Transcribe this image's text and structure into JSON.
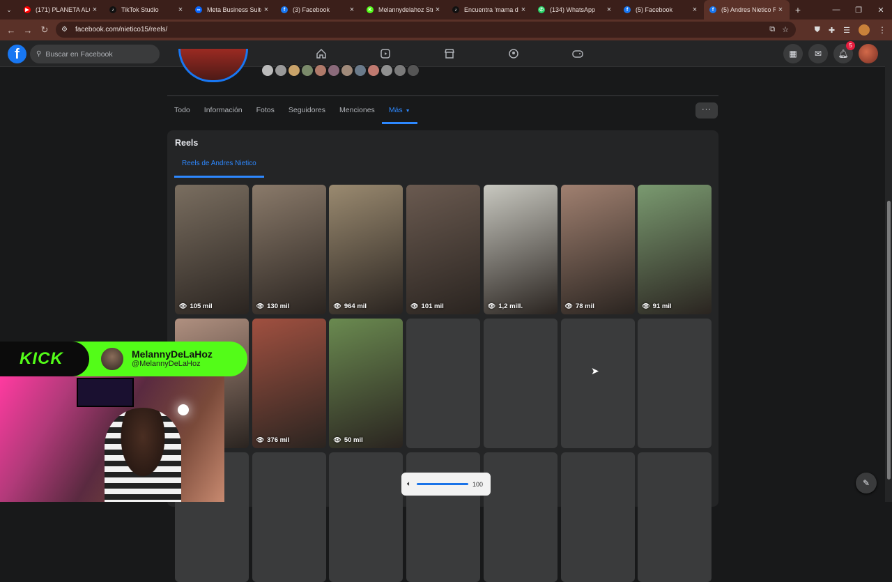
{
  "browser": {
    "tabs": [
      {
        "title": "(171) PLANETA ALOF",
        "color": "#ff0000",
        "glyph": "▶"
      },
      {
        "title": "TikTok Studio",
        "color": "#111111",
        "glyph": "♪"
      },
      {
        "title": "Meta Business Suite",
        "color": "#0866ff",
        "glyph": "∞"
      },
      {
        "title": "(3) Facebook",
        "color": "#1877f2",
        "glyph": "f"
      },
      {
        "title": "Melannydelahoz Stre",
        "color": "#53fc18",
        "glyph": "K"
      },
      {
        "title": "Encuentra 'mama de",
        "color": "#111111",
        "glyph": "♪"
      },
      {
        "title": "(134) WhatsApp",
        "color": "#25d366",
        "glyph": "✆"
      },
      {
        "title": "(5) Facebook",
        "color": "#1877f2",
        "glyph": "f"
      },
      {
        "title": "(5) Andres Nietico Re",
        "color": "#1877f2",
        "glyph": "f",
        "active": true
      }
    ],
    "url": "facebook.com/nietico15/reels/"
  },
  "fb": {
    "search_placeholder": "Buscar en Facebook",
    "notification_count": "5"
  },
  "profile_tabs": [
    "Todo",
    "Información",
    "Fotos",
    "Seguidores",
    "Menciones",
    "Más"
  ],
  "reels": {
    "title": "Reels",
    "subtab": "Reels de Andres Nietico",
    "row1": [
      "105 mil",
      "130 mil",
      "964 mil",
      "101 mil",
      "1,2 mill.",
      "78 mil",
      "91 mil"
    ],
    "row2": [
      "",
      "376 mil",
      "50 mil",
      "",
      "",
      "",
      ""
    ],
    "tile_colors_row1": [
      "#7a6e60",
      "#8a7a6a",
      "#9a8a70",
      "#6a5a50",
      "#c8c8c0",
      "#a08070",
      "#7a9a70"
    ],
    "tile_colors_row2": [
      "#b09080",
      "#a05040",
      "#6a8a50",
      "#3a3b3c",
      "#3a3b3c",
      "#3a3b3c",
      "#3a3b3c"
    ]
  },
  "kick": {
    "logo": "KICK",
    "name": "MelannyDeLaHoz",
    "handle": "@MelannyDeLaHoz"
  },
  "volume": {
    "level": "100"
  }
}
